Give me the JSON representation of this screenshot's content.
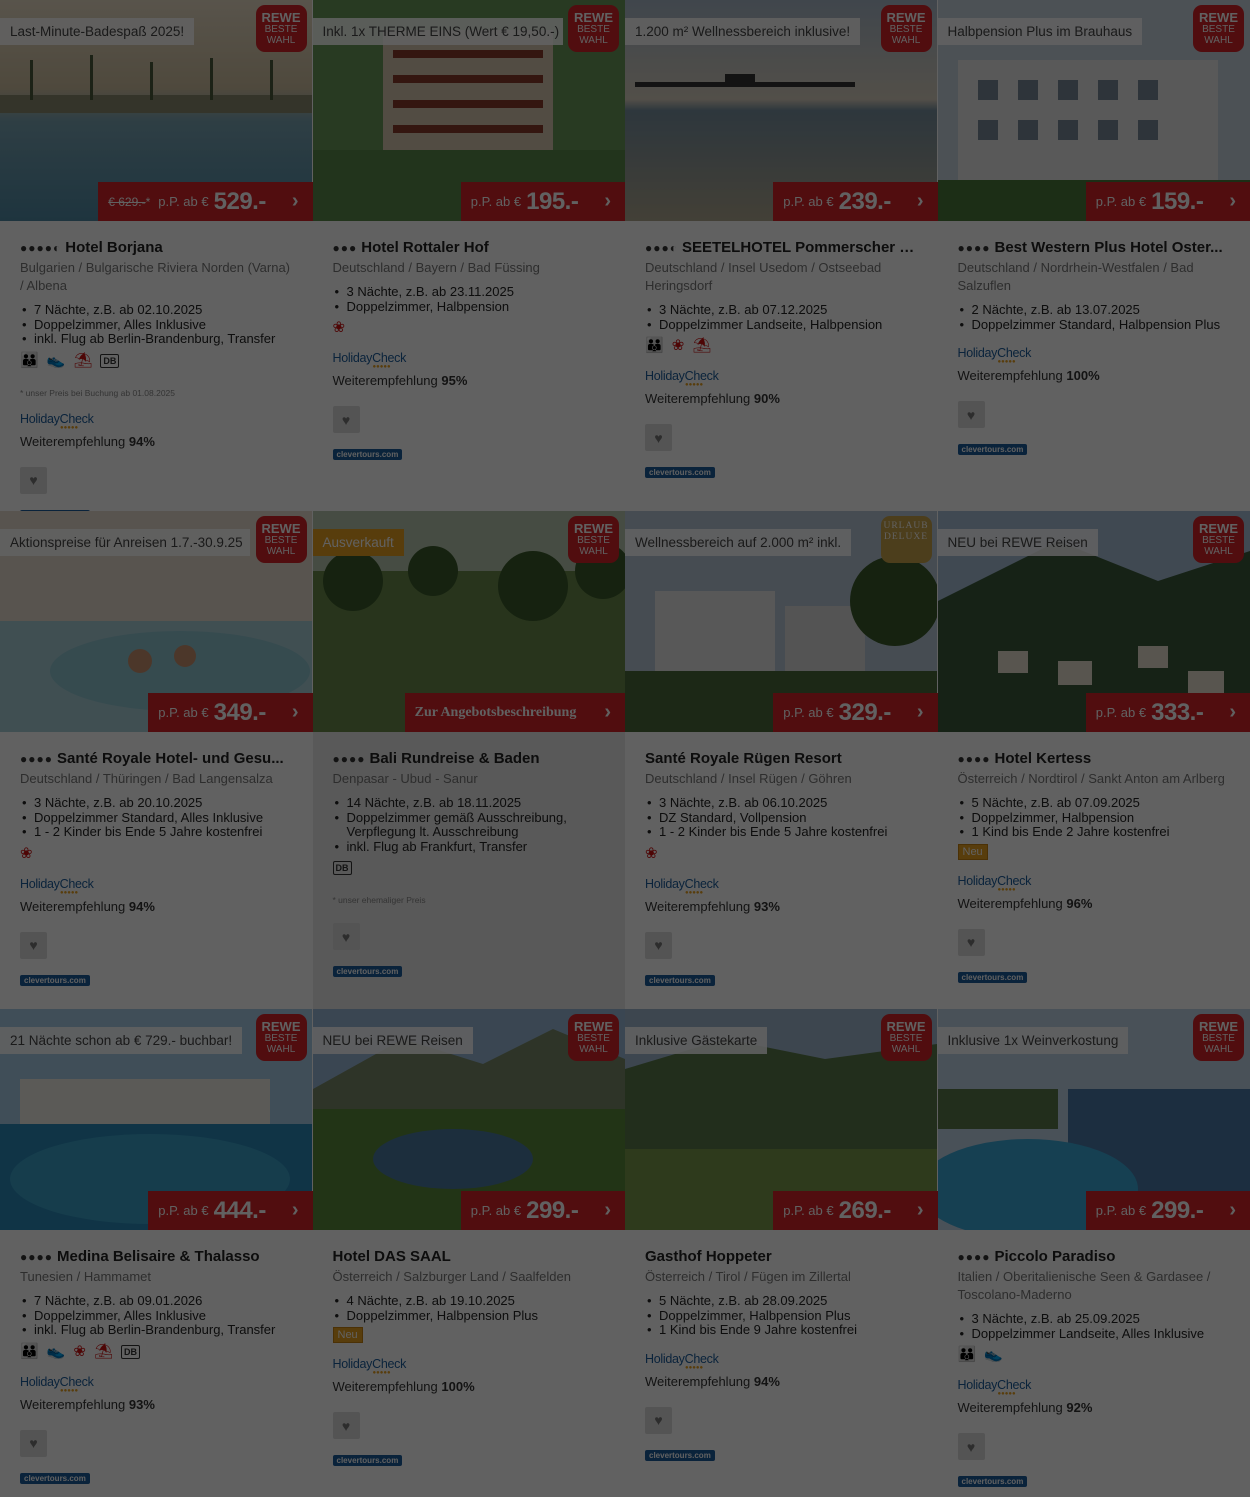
{
  "cards": [
    {
      "tag": "Last-Minute-Badespaß 2025!",
      "tag_style": "white",
      "badge": "rewe",
      "old_price": "€ 629.-",
      "old_star": "*",
      "price_prefix": "p.P. ab €",
      "price": "529.-",
      "stars": "●●●●◐",
      "name": "Hotel Borjana",
      "location": "Bulgarien / Bulgarische Riviera Norden (Varna) / Albena",
      "features": [
        "7 Nächte, z.B. ab 02.10.2025",
        "Doppelzimmer, Alles Inklusive",
        "inkl. Flug ab Berlin-Brandenburg, Transfer"
      ],
      "icons": [
        "family-icon",
        "shoe-icon",
        "beach-icon",
        "db-icon"
      ],
      "note": "* unser Preis bei Buchung ab 01.08.2025",
      "hc_logo": "HolidayCheck",
      "hc_label": "Weiterempfehlung",
      "hc_value": "94%",
      "ct_logo": "clevertours.com",
      "scene": "sea"
    },
    {
      "tag": "Inkl. 1x THERME EINS (Wert € 19,50.-)",
      "tag_style": "white",
      "badge": "rewe",
      "price_prefix": "p.P. ab €",
      "price": "195.-",
      "stars": "●●●",
      "name": "Hotel Rottaler Hof",
      "location": "Deutschland / Bayern / Bad Füssing",
      "features": [
        "3 Nächte, z.B. ab 23.11.2025",
        "Doppelzimmer, Halbpension"
      ],
      "icons": [
        "wellness-icon"
      ],
      "hc_logo": "HolidayCheck",
      "hc_label": "Weiterempfehlung",
      "hc_value": "95%",
      "ct_logo": "clevertours.com",
      "scene": "hotel"
    },
    {
      "tag": "1.200 m² Wellnessbereich inklusive!",
      "tag_style": "white",
      "badge": "rewe",
      "price_prefix": "p.P. ab €",
      "price": "239.-",
      "stars": "●●●◐",
      "name": "SEETELHOTEL Pommerscher Hof",
      "location": "Deutschland / Insel Usedom / Ostseebad Heringsdorf",
      "features": [
        "3 Nächte, z.B. ab 07.12.2025",
        "Doppelzimmer Landseite, Halbpension"
      ],
      "icons": [
        "family-icon",
        "wellness-icon",
        "beach-icon"
      ],
      "hc_logo": "HolidayCheck",
      "hc_label": "Weiterempfehlung",
      "hc_value": "90%",
      "ct_logo": "clevertours.com",
      "scene": "pier"
    },
    {
      "tag": "Halbpension Plus im Brauhaus",
      "tag_style": "white",
      "badge": "rewe",
      "price_prefix": "p.P. ab €",
      "price": "159.-",
      "stars": "●●●●",
      "name": "Best Western Plus Hotel Oster...",
      "location": "Deutschland / Nordrhein-Westfalen / Bad Salzuflen",
      "features": [
        "2 Nächte, z.B. ab 13.07.2025",
        "Doppelzimmer Standard, Halbpension Plus"
      ],
      "icons": [],
      "hc_logo": "HolidayCheck",
      "hc_label": "Weiterempfehlung",
      "hc_value": "100%",
      "ct_logo": "clevertours.com",
      "scene": "building"
    },
    {
      "tag": "Aktionspreise für Anreisen 1.7.-30.9.25",
      "tag_style": "white",
      "badge": "rewe",
      "price_prefix": "p.P. ab €",
      "price": "349.-",
      "stars": "●●●●",
      "name": "Santé Royale Hotel- und Gesu...",
      "location": "Deutschland / Thüringen / Bad Langensalza",
      "features": [
        "3 Nächte, z.B. ab 20.10.2025",
        "Doppelzimmer Standard, Alles Inklusive",
        "1 - 2 Kinder bis Ende 5 Jahre kostenfrei"
      ],
      "icons": [
        "wellness-icon"
      ],
      "hc_logo": "HolidayCheck",
      "hc_label": "Weiterempfehlung",
      "hc_value": "94%",
      "ct_logo": "clevertours.com",
      "scene": "pool-winter"
    },
    {
      "tag": "Ausverkauft",
      "tag_style": "orange",
      "badge": "rewe",
      "cta": "Zur Angebotsbeschreibung",
      "stars": "●●●●",
      "name": "Bali Rundreise & Baden",
      "location": "Denpasar - Ubud - Sanur",
      "features": [
        "14 Nächte, z.B. ab 18.11.2025",
        "Doppelzimmer gemäß Ausschreibung, Verpflegung lt. Ausschreibung",
        "inkl. Flug ab Frankfurt, Transfer"
      ],
      "icons": [
        "db-icon"
      ],
      "note": "* unser ehemaliger Preis",
      "ct_logo": "clevertours.com",
      "grey": true,
      "scene": "jungle"
    },
    {
      "tag": "Wellnessbereich auf 2.000 m² inkl.",
      "tag_style": "white",
      "badge": "deluxe",
      "badge_line1": "URLAUB",
      "badge_line2": "DELUXE",
      "price_prefix": "p.P. ab €",
      "price": "329.-",
      "stars": "",
      "name": "Santé Royale Rügen Resort",
      "location": "Deutschland / Insel Rügen / Göhren",
      "features": [
        "3 Nächte, z.B. ab 06.10.2025",
        "DZ Standard, Vollpension",
        "1 - 2 Kinder bis Ende 5 Jahre kostenfrei"
      ],
      "icons": [
        "wellness-icon"
      ],
      "hc_logo": "HolidayCheck",
      "hc_label": "Weiterempfehlung",
      "hc_value": "93%",
      "ct_logo": "clevertours.com",
      "scene": "resort"
    },
    {
      "tag": "NEU bei REWE Reisen",
      "tag_style": "white",
      "badge": "rewe",
      "price_prefix": "p.P. ab €",
      "price": "333.-",
      "stars": "●●●●",
      "name": "Hotel Kertess",
      "location": "Österreich / Nordtirol / Sankt Anton am Arlberg",
      "features": [
        "5 Nächte, z.B. ab 07.09.2025",
        "Doppelzimmer, Halbpension",
        "1 Kind bis Ende 2 Jahre kostenfrei"
      ],
      "icons": [],
      "neu": "Neu",
      "hc_logo": "HolidayCheck",
      "hc_label": "Weiterempfehlung",
      "hc_value": "96%",
      "ct_logo": "clevertours.com",
      "scene": "alpine"
    },
    {
      "tag": "21 Nächte schon ab € 729.- buchbar!",
      "tag_style": "white",
      "badge": "rewe",
      "price_prefix": "p.P. ab €",
      "price": "444.-",
      "stars": "●●●●",
      "name": "Medina Belisaire & Thalasso",
      "location": "Tunesien / Hammamet",
      "features": [
        "7 Nächte, z.B. ab 09.01.2026",
        "Doppelzimmer, Alles Inklusive",
        "inkl. Flug ab Berlin-Brandenburg, Transfer"
      ],
      "icons": [
        "family-icon",
        "shoe-icon",
        "wellness-icon",
        "beach-icon",
        "db-icon"
      ],
      "hc_logo": "HolidayCheck",
      "hc_label": "Weiterempfehlung",
      "hc_value": "93%",
      "ct_logo": "clevertours.com",
      "scene": "pool"
    },
    {
      "tag": "NEU bei REWE Reisen",
      "tag_style": "white",
      "badge": "rewe",
      "price_prefix": "p.P. ab €",
      "price": "299.-",
      "stars": "",
      "name": "Hotel DAS SAAL",
      "location": "Österreich / Salzburger Land / Saalfelden",
      "features": [
        "4 Nächte, z.B. ab 19.10.2025",
        "Doppelzimmer, Halbpension Plus"
      ],
      "icons": [],
      "neu": "Neu",
      "hc_logo": "HolidayCheck",
      "hc_label": "Weiterempfehlung",
      "hc_value": "100%",
      "ct_logo": "clevertours.com",
      "scene": "lake"
    },
    {
      "tag": "Inklusive Gästekarte",
      "tag_style": "white",
      "badge": "rewe",
      "price_prefix": "p.P. ab €",
      "price": "269.-",
      "stars": "",
      "name": "Gasthof Hoppeter",
      "location": "Österreich / Tirol / Fügen im Zillertal",
      "features": [
        "5 Nächte, z.B. ab 28.09.2025",
        "Doppelzimmer, Halbpension Plus",
        "1 Kind bis Ende 9 Jahre kostenfrei"
      ],
      "icons": [],
      "hc_logo": "HolidayCheck",
      "hc_label": "Weiterempfehlung",
      "hc_value": "94%",
      "ct_logo": "clevertours.com",
      "scene": "valley"
    },
    {
      "tag": "Inklusive 1x Weinverkostung",
      "tag_style": "white",
      "badge": "rewe",
      "price_prefix": "p.P. ab €",
      "price": "299.-",
      "stars": "●●●●",
      "name": "Piccolo Paradiso",
      "location": "Italien / Oberitalienische Seen & Gardasee / Toscolano-Maderno",
      "features": [
        "3 Nächte, z.B. ab 25.09.2025",
        "Doppelzimmer Landseite, Alles Inklusive"
      ],
      "icons": [
        "family-icon",
        "shoe-icon"
      ],
      "hc_logo": "HolidayCheck",
      "hc_label": "Weiterempfehlung",
      "hc_value": "92%",
      "ct_logo": "clevertours.com",
      "scene": "garda"
    }
  ],
  "badge_rewe": {
    "line1": "REWE",
    "line2": "BESTE",
    "line3": "WAHL"
  },
  "colors": {
    "brand_red": "#d42428",
    "tag_orange": "#e8a020",
    "hc_blue": "#1c5c9c",
    "overlay": "rgba(0,0,0,0.62)"
  },
  "icon_glyphs": {
    "family-icon": "👪",
    "shoe-icon": "👟",
    "beach-icon": "⛱",
    "wellness-icon": "❀",
    "db-icon": "DB"
  }
}
